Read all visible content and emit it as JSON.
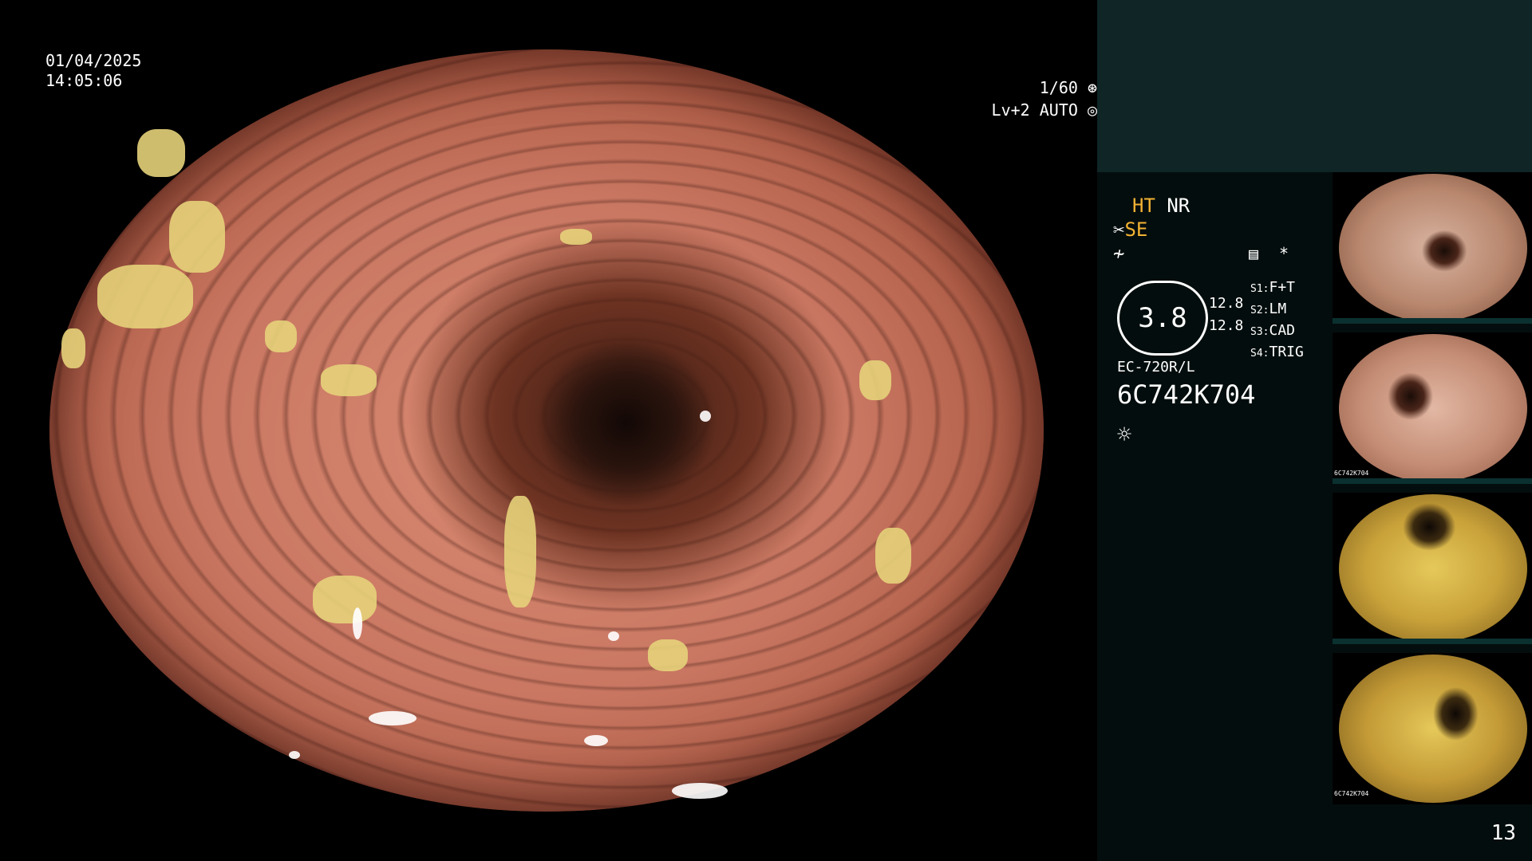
{
  "endoscope_view": {
    "date": "01/04/2025",
    "time": "14:05:06",
    "shutter": "1/60",
    "level": "Lv+2 AUTO"
  },
  "side_panel": {
    "status_ht": "HT",
    "status_nr": "NR",
    "status_se": "SE",
    "gauge_value": "3.8",
    "value_upper": "12.8",
    "value_lower": "12.8",
    "s1_label": "S1:",
    "s1_value": "F+T",
    "s2_label": "S2:",
    "s2_value": "LM",
    "s3_label": "S3:",
    "s3_value": "CAD",
    "s4_label": "S4:",
    "s4_value": "TRIG",
    "asterisk": "*",
    "scope_model": "EC-720R/L",
    "serial": "6C742K704",
    "thumb_label": "6C742K704"
  },
  "page_number": "13",
  "icons": {
    "shutter": "aperture-icon",
    "auto": "auto-iris-icon",
    "scissors": "scissors-icon",
    "lightning": "lightning-icon",
    "memory": "memory-card-icon",
    "light": "sun-icon"
  }
}
